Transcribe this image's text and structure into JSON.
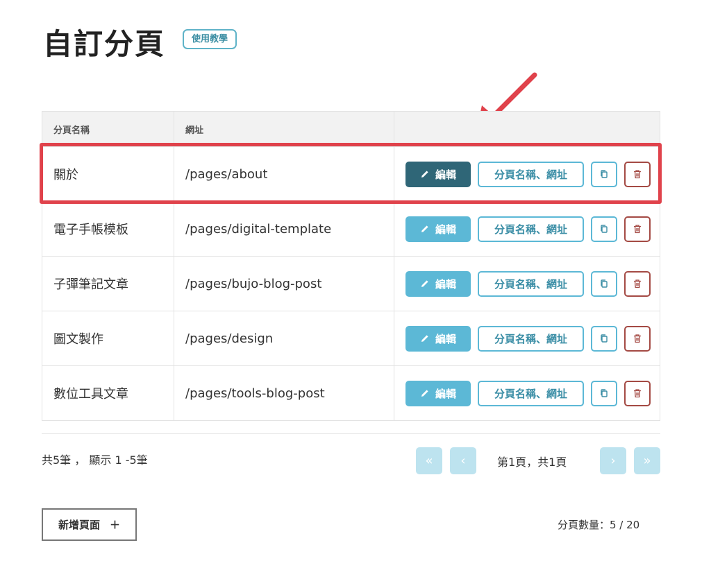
{
  "header": {
    "title": "自訂分頁",
    "tutorial_label": "使用教學"
  },
  "table": {
    "columns": [
      "分頁名稱",
      "網址",
      ""
    ],
    "rows": [
      {
        "name": "關於",
        "url": "/pages/about"
      },
      {
        "name": "電子手帳模板",
        "url": "/pages/digital-template"
      },
      {
        "name": "子彈筆記文章",
        "url": "/pages/bujo-blog-post"
      },
      {
        "name": "圖文製作",
        "url": "/pages/design"
      },
      {
        "name": "數位工具文章",
        "url": "/pages/tools-blog-post"
      }
    ],
    "actions": {
      "edit_label": "編輯",
      "rename_label": "分頁名稱、網址"
    }
  },
  "footer": {
    "summary": "共5筆 ， 顯示 1 -5筆",
    "pagination": {
      "first": "«",
      "prev": "‹",
      "next": "›",
      "last": "»",
      "page_info": "第1頁，共1頁"
    },
    "add_button_label": "新增頁面",
    "add_icon": "＋",
    "quota": "分頁數量：5 / 20"
  },
  "colors": {
    "accent": "#5cb8d6",
    "edit_active": "#2f6677",
    "delete": "#a44a44",
    "highlight": "#e0424b"
  },
  "icons": [
    "pencil-icon",
    "copy-icon",
    "trash-icon",
    "plus-icon"
  ]
}
